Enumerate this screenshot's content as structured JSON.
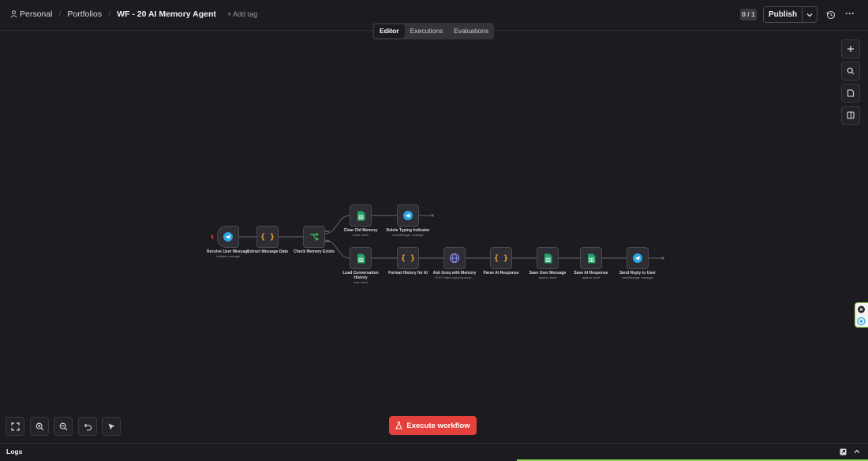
{
  "header": {
    "breadcrumb_workspace": "Personal",
    "breadcrumb_folder": "Portfolios",
    "workflow_title": "WF - 20 AI Memory Agent",
    "add_tag": "+ Add tag",
    "counter": "0 / 1",
    "publish_label": "Publish"
  },
  "tabs": [
    "Editor",
    "Executions",
    "Evaluations"
  ],
  "nodes": [
    {
      "id": "receive",
      "label": "Receive User Message",
      "sub": "Updates: message",
      "icon": "telegram-icon"
    },
    {
      "id": "extract",
      "label": "Extract Message Data",
      "sub": "",
      "icon": "code-braces-icon"
    },
    {
      "id": "check",
      "label": "Check Memory Exists",
      "sub": "",
      "icon": "switch-icon"
    },
    {
      "id": "clear",
      "label": "Clear Old Memory",
      "sub": "delete: sheet",
      "icon": "google-sheets-icon"
    },
    {
      "id": "typing",
      "label": "Delete Typing Indicator",
      "sub": "sendMessage: message",
      "icon": "telegram-icon"
    },
    {
      "id": "load",
      "label": "Load Conversation History",
      "sub": "read: sheet",
      "icon": "google-sheets-icon"
    },
    {
      "id": "format",
      "label": "Format History for AI",
      "sub": "",
      "icon": "code-braces-icon"
    },
    {
      "id": "ask",
      "label": "Ask Groq with Memory",
      "sub": "POST: https://api.groq.com/o...",
      "icon": "globe-icon"
    },
    {
      "id": "parse",
      "label": "Parse AI Response",
      "sub": "",
      "icon": "code-braces-icon"
    },
    {
      "id": "saveuser",
      "label": "Save User Message",
      "sub": "append: sheet",
      "icon": "google-sheets-icon"
    },
    {
      "id": "saveai",
      "label": "Save AI Response",
      "sub": "append: sheet",
      "icon": "google-sheets-icon"
    },
    {
      "id": "reply",
      "label": "Send Reply to User",
      "sub": "sendMessage: message",
      "icon": "telegram-icon"
    }
  ],
  "branch_labels": {
    "true": "true",
    "false": "false"
  },
  "execute_label": "Execute workflow",
  "logs_label": "Logs",
  "colors": {
    "accent_red": "#e5413c",
    "sheets_green": "#21a366",
    "telegram_blue": "#2aa3e0",
    "code_orange": "#f2a33b",
    "switch_green": "#3fb950",
    "http_purple": "#8b8ff7"
  }
}
